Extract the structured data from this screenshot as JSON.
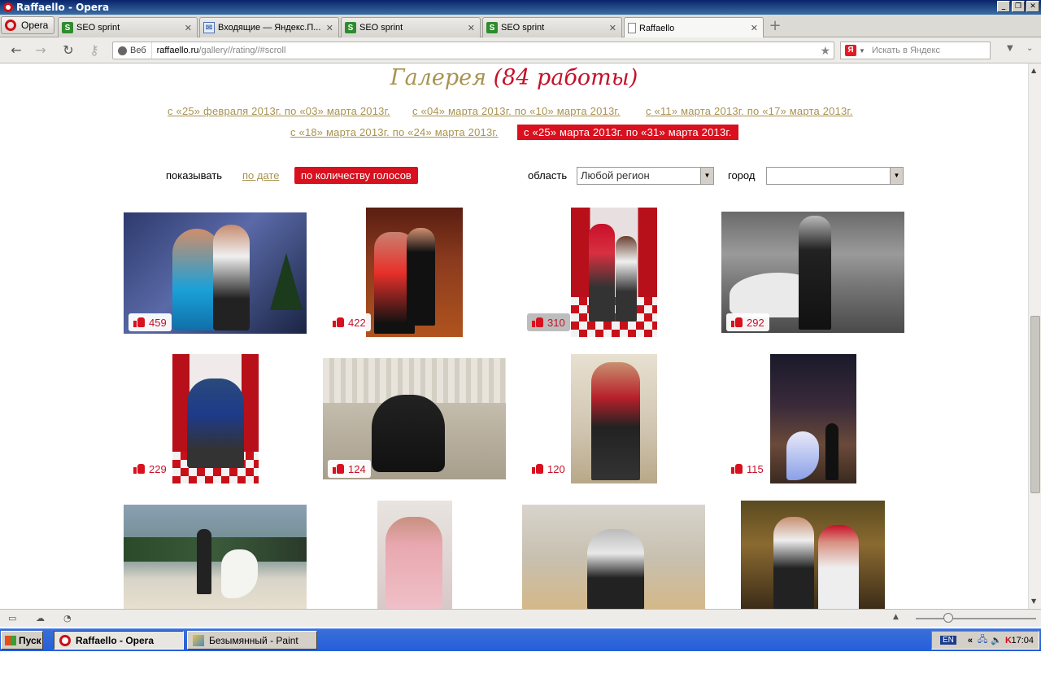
{
  "window": {
    "title": "Raffaello - Opera"
  },
  "tabs": {
    "opera_menu": "Opera",
    "items": [
      {
        "label": "SEO sprint",
        "icon": "seo-sprint-icon"
      },
      {
        "label": "Входящие — Яндекс.П...",
        "icon": "mail-icon"
      },
      {
        "label": "SEO sprint",
        "icon": "seo-sprint-icon"
      },
      {
        "label": "SEO sprint",
        "icon": "seo-sprint-icon"
      },
      {
        "label": "Raffaello",
        "icon": "page-icon"
      }
    ]
  },
  "address": {
    "web_label": "Веб",
    "domain": "raffaello.ru",
    "path": "/gallery//rating//#scroll",
    "search_placeholder": "Искать в Яндекс",
    "search_engine_badge": "Я"
  },
  "gallery": {
    "title_main": "Галерея",
    "title_count": "(84 работы)",
    "weeks": [
      "с «25» февраля 2013г. по «03» марта 2013г.",
      "с «04» марта 2013г. по «10» марта 2013г.",
      "с «11» марта 2013г. по «17» марта 2013г.",
      "с «18» марта 2013г. по «24» марта 2013г.",
      "с «25» марта 2013г. по «31» марта 2013г."
    ],
    "selected_week_index": 4,
    "filters": {
      "show_label": "показывать",
      "by_date": "по дате",
      "by_votes": "по количеству голосов",
      "region_label": "область",
      "region_value": "Любой регион",
      "city_label": "город",
      "city_value": ""
    },
    "photos": [
      {
        "votes": "459",
        "highlight": false
      },
      {
        "votes": "422",
        "highlight": false
      },
      {
        "votes": "310",
        "highlight": true
      },
      {
        "votes": "292",
        "highlight": false
      },
      {
        "votes": "229",
        "highlight": false
      },
      {
        "votes": "124",
        "highlight": false
      },
      {
        "votes": "120",
        "highlight": false
      },
      {
        "votes": "115",
        "highlight": false
      }
    ]
  },
  "taskbar": {
    "start": "Пуск",
    "tasks": [
      "Raffaello - Opera",
      "Безымянный - Paint"
    ],
    "lang": "EN",
    "clock": "17:04"
  },
  "colors": {
    "accent_red": "#d9101e",
    "gold": "#a89350"
  }
}
